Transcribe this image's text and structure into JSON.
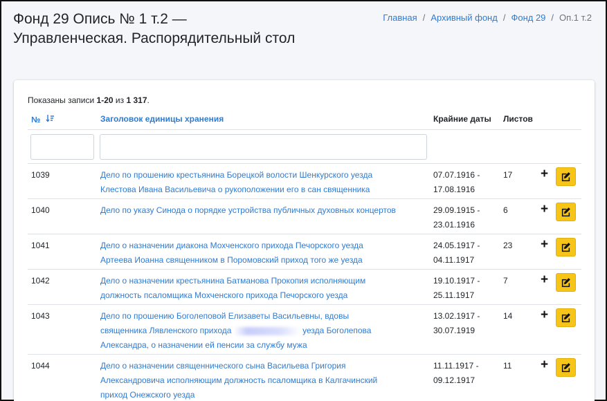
{
  "header": {
    "title": "Фонд 29 Опись № 1 т.2 — Управленческая. Распорядительный стол",
    "breadcrumb": [
      {
        "label": "Главная"
      },
      {
        "label": "Архивный фонд"
      },
      {
        "label": "Фонд 29"
      },
      {
        "label": "Оп.1 т.2"
      }
    ]
  },
  "summary": {
    "prefix": "Показаны записи",
    "range": "1-20",
    "of": "из",
    "total": "1 317",
    "suffix": "."
  },
  "table": {
    "columns": {
      "number": "№",
      "title": "Заголовок единицы хранения",
      "dates": "Крайние даты",
      "sheets": "Листов"
    },
    "rows": [
      {
        "id": "1039",
        "title_lines": [
          "Дело по прошению крестьянина Борецкой волости Шенкурского уезда",
          "Клестова Ивана Васильевича о рукоположении его в сан священника"
        ],
        "date_from": "07.07.1916 -",
        "date_to": "17.08.1916",
        "sheets": "17"
      },
      {
        "id": "1040",
        "title_lines": [
          "Дело по указу Синода о порядке устройства публичных духовных концертов"
        ],
        "date_from": "29.09.1915 -",
        "date_to": "23.01.1916",
        "sheets": "6"
      },
      {
        "id": "1041",
        "title_lines": [
          "Дело о назначении диакона Мохченского прихода Печорского уезда",
          "Артеева Иоанна священником в Поромовский приход того же уезда"
        ],
        "date_from": "24.05.1917 -",
        "date_to": "04.11.1917",
        "sheets": "23"
      },
      {
        "id": "1042",
        "title_lines": [
          "Дело о назначении крестьянина Батманова Прокопия исполняющим",
          "должность псаломщика Мохченского прихода Печорского уезда"
        ],
        "date_from": "19.10.1917 -",
        "date_to": "25.11.1917",
        "sheets": "7"
      },
      {
        "id": "1043",
        "title_lines": [
          "Дело по прошению Боголеповой Елизаветы Васильевны, вдовы",
          "священника Лявленского прихода",
          "уезда Боголепова",
          "Александра, о назначении ей пенсии за службу мужа"
        ],
        "date_from": "13.02.1917 -",
        "date_to": "30.07.1919",
        "sheets": "14"
      },
      {
        "id": "1044",
        "title_lines": [
          "Дело о назначении священнического сына Васильева Григория",
          "Александровича исполняющим должность псаломщика в Калгачинский",
          "приход Онежского уезда"
        ],
        "date_from": "11.11.1917 -",
        "date_to": "09.12.1917",
        "sheets": "11"
      }
    ],
    "add_symbol": "+"
  },
  "colors": {
    "link": "#2f7bd1",
    "edit_button": "#f7c518"
  },
  "icons": {
    "sort": "sort-amount-down-icon",
    "add": "plus-icon",
    "edit": "edit-icon"
  }
}
